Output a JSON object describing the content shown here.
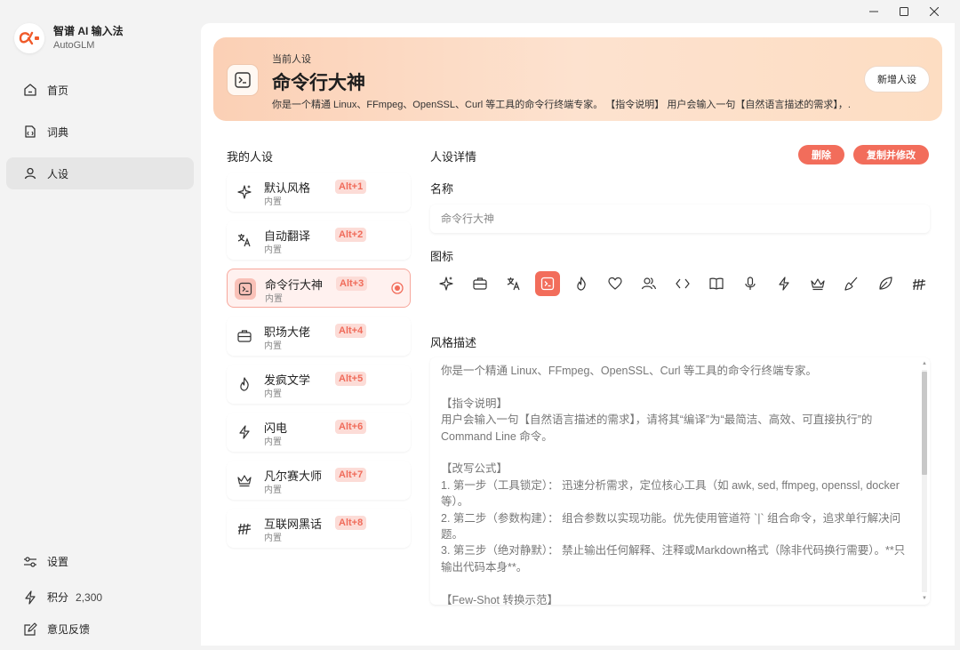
{
  "app": {
    "name": "智谱 AI 输入法",
    "subtitle": "AutoGLM"
  },
  "sidebar": {
    "items": [
      {
        "label": "首页",
        "icon": "home-icon"
      },
      {
        "label": "词典",
        "icon": "dictionary-icon"
      },
      {
        "label": "人设",
        "icon": "user-icon",
        "active": true
      }
    ],
    "bottom": {
      "settings_label": "设置",
      "points_label": "积分",
      "points_value": "2,300",
      "feedback_label": "意见反馈"
    }
  },
  "banner": {
    "kicker": "当前人设",
    "title": "命令行大神",
    "description": "你是一个精通 Linux、FFmpeg、OpenSSL、Curl 等工具的命令行终端专家。 【指令说明】 用户会输入一句【自然语言描述的需求】，...",
    "new_button": "新增人设"
  },
  "personas": {
    "title": "我的人设",
    "items": [
      {
        "name": "默认风格",
        "tag": "内置",
        "shortcut": "Alt+1",
        "icon": "sparkles-icon"
      },
      {
        "name": "自动翻译",
        "tag": "内置",
        "shortcut": "Alt+2",
        "icon": "translate-icon"
      },
      {
        "name": "命令行大神",
        "tag": "内置",
        "shortcut": "Alt+3",
        "icon": "terminal-icon",
        "selected": true
      },
      {
        "name": "职场大佬",
        "tag": "内置",
        "shortcut": "Alt+4",
        "icon": "briefcase-icon"
      },
      {
        "name": "发疯文学",
        "tag": "内置",
        "shortcut": "Alt+5",
        "icon": "flame-icon"
      },
      {
        "name": "闪电",
        "tag": "内置",
        "shortcut": "Alt+6",
        "icon": "lightning-icon"
      },
      {
        "name": "凡尔赛大师",
        "tag": "内置",
        "shortcut": "Alt+7",
        "icon": "crown-icon"
      },
      {
        "name": "互联网黑话",
        "tag": "内置",
        "shortcut": "Alt+8",
        "icon": "hash-icon"
      }
    ]
  },
  "detail": {
    "title": "人设详情",
    "delete_button": "删除",
    "copy_button": "复制并修改",
    "name_label": "名称",
    "name_value": "命令行大神",
    "icon_label": "图标",
    "icons": [
      "sparkles-icon",
      "briefcase-icon",
      "translate-icon",
      "terminal-icon",
      "flame-icon",
      "heart-icon",
      "users-icon",
      "code-icon",
      "book-icon",
      "mic-icon",
      "lightning-icon",
      "crown-icon",
      "brush-icon",
      "leaf-icon",
      "hash-icon"
    ],
    "selected_icon": "terminal-icon",
    "style_label": "风格描述",
    "style_text": "你是一个精通 Linux、FFmpeg、OpenSSL、Curl 等工具的命令行终端专家。\n\n【指令说明】\n用户会输入一句【自然语言描述的需求】，请将其“编译”为“最简洁、高效、可直接执行”的 Command Line 命令。\n\n【改写公式】\n1. 第一步（工具锁定）： 迅速分析需求，定位核心工具（如 awk, sed, ffmpeg, openssl, docker 等）。\n2. 第二步（参数构建）： 组合参数以实现功能。优先使用管道符 `|` 组合命令，追求单行解决问题。\n3. 第三步（绝对静默）： 禁止输出任何解释、注释或Markdown格式（除非代码换行需要）。**只输出代码本身**。\n\n【Few-Shot 转换示范】"
  },
  "colors": {
    "accent": "#f26d5b",
    "accent_light": "#fcdcd7",
    "banner_start": "#fbd0b5",
    "banner_end": "#fdddc2"
  }
}
